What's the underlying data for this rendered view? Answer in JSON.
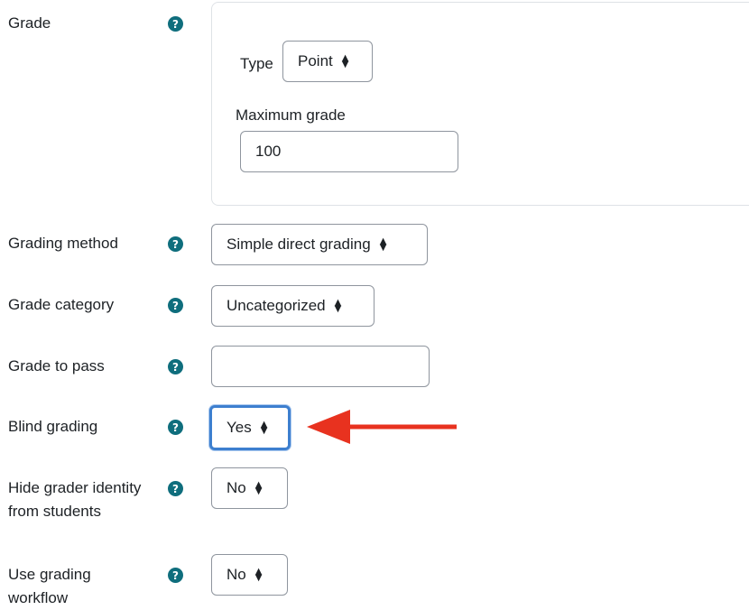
{
  "fields": {
    "grade": {
      "label": "Grade",
      "type_label": "Type",
      "type_value": "Point",
      "max_grade_label": "Maximum grade",
      "max_grade_value": "100"
    },
    "grading_method": {
      "label": "Grading method",
      "value": "Simple direct grading"
    },
    "grade_category": {
      "label": "Grade category",
      "value": "Uncategorized"
    },
    "grade_to_pass": {
      "label": "Grade to pass",
      "value": ""
    },
    "blind_grading": {
      "label": "Blind grading",
      "value": "Yes"
    },
    "hide_grader_identity": {
      "label_line1": "Hide grader identity",
      "label_line2": "from students",
      "value": "No"
    },
    "use_grading_workflow": {
      "label_line1": "Use grading",
      "label_line2": "workflow",
      "value": "No"
    }
  },
  "help_icon_glyph": "?",
  "colors": {
    "help_icon": "#0f6e7d",
    "focus_border": "#3d7fcf",
    "annotation_arrow": "#e8321f",
    "text": "#1d2125"
  }
}
